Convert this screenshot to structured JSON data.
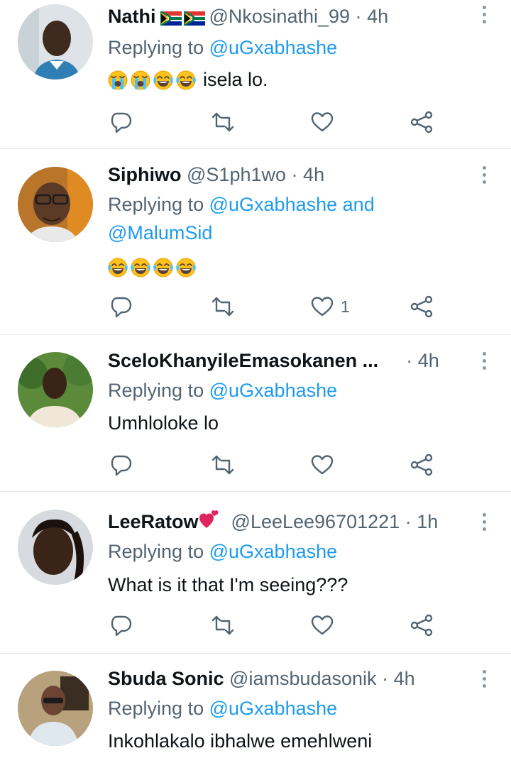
{
  "tweets": [
    {
      "name": "Nathi",
      "flags": [
        "south-africa-flag",
        "south-africa-flag"
      ],
      "handle": "@Nkosinathi_99",
      "separator": "·",
      "time": "4h",
      "reply_prefix": "Replying to",
      "mentions": [
        "@uGxabhashe"
      ],
      "emojis": [
        "loudly-crying-face",
        "loudly-crying-face",
        "tears-of-joy",
        "tears-of-joy"
      ],
      "text": "isela lo.",
      "like_count": ""
    },
    {
      "name": "Siphiwo",
      "handle": "@S1ph1wo",
      "separator": "·",
      "time": "4h",
      "reply_prefix": "Replying to",
      "mentions": [
        "@uGxabhashe",
        "@MalumSid"
      ],
      "reply_and": "and",
      "emojis": [
        "tears-of-joy",
        "tears-of-joy",
        "tears-of-joy",
        "tears-of-joy"
      ],
      "text": "",
      "like_count": "1"
    },
    {
      "name": "SceloKhanyileEmasokanen ...",
      "handle": "",
      "separator": "·",
      "time": "4h",
      "reply_prefix": "Replying to",
      "mentions": [
        "@uGxabhashe"
      ],
      "text": "Umhloloke lo",
      "like_count": ""
    },
    {
      "name": "LeeRatow",
      "name_emoji": "heart-with-ribbon",
      "handle": "@LeeLee96701221",
      "separator": "·",
      "time": "1h",
      "reply_prefix": "Replying to",
      "mentions": [
        "@uGxabhashe"
      ],
      "text": "What is it that I'm seeing???",
      "like_count": ""
    },
    {
      "name": "Sbuda Sonic",
      "handle": "@iamsbudasonik",
      "separator": "·",
      "time": "4h",
      "reply_prefix": "Replying to",
      "mentions": [
        "@uGxabhashe"
      ],
      "text": "Inkohlakalo ibhalwe emehlweni",
      "like_count": ""
    }
  ],
  "colors": {
    "accent": "#1d9bf0",
    "secondary_text": "#536471",
    "divider": "#e3e7ea",
    "icon": "#536471"
  },
  "icons": {
    "reply": "reply-icon",
    "retweet": "retweet-icon",
    "like": "like-icon",
    "share": "share-icon",
    "more": "more-icon"
  }
}
